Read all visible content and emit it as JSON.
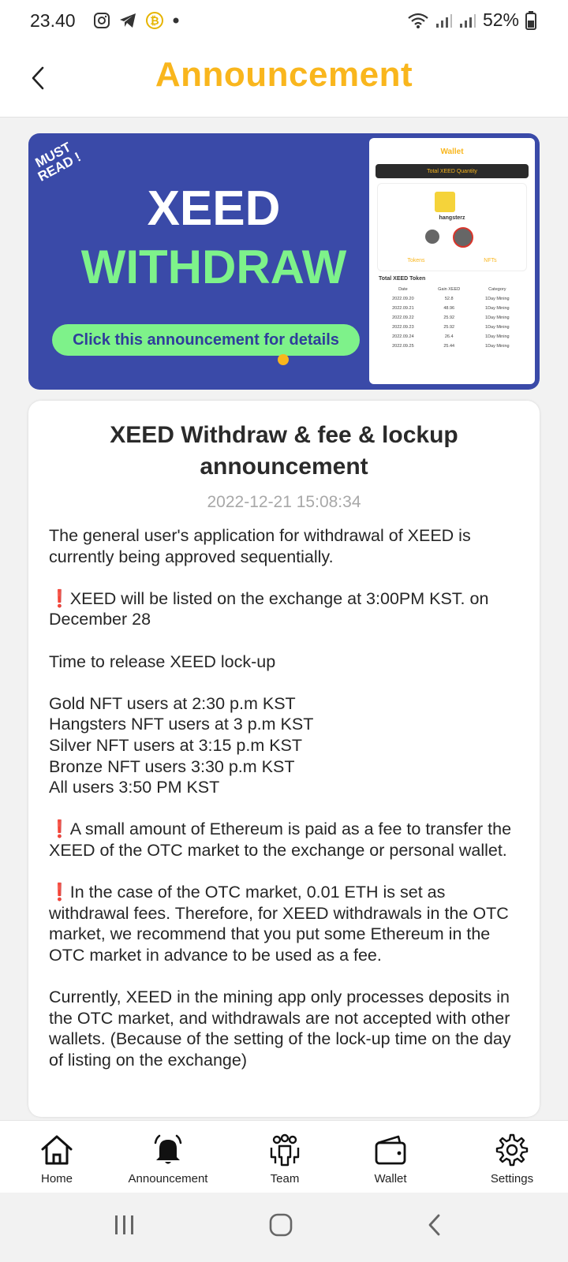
{
  "status_bar": {
    "time": "23.40",
    "battery": "52%",
    "icons": [
      "instagram-icon",
      "telegram-icon",
      "bitcoin-icon",
      "dot-icon",
      "wifi-icon",
      "signal-icon",
      "battery-icon"
    ]
  },
  "header": {
    "title": "Announcement",
    "title_color": "#f9b61d"
  },
  "banner": {
    "badge": "MUST\nREAD !",
    "line1": "XEED",
    "line2": "WITHDRAW",
    "cta": "Click this announcement for details",
    "phone": {
      "title": "Wallet",
      "bar_label": "Total XEED Quantity",
      "username": "hangsterz",
      "tab1": "Tokens",
      "tab2": "NFTs",
      "token_label": "Total XEED Token",
      "headers": [
        "Date",
        "Gain XEED",
        "Category"
      ],
      "rows": [
        [
          "2022.09.20",
          "52.8",
          "1Day Mining"
        ],
        [
          "2022.09.21",
          "48.96",
          "1Day Mining"
        ],
        [
          "2022.09.22",
          "25.92",
          "1Day Mining"
        ],
        [
          "2022.09.23",
          "25.92",
          "1Day Mining"
        ],
        [
          "2022.09.24",
          "26.4",
          "1Day Mining"
        ],
        [
          "2022.09.25",
          "25.44",
          "1Day Mining"
        ]
      ]
    }
  },
  "announcement": {
    "title": "XEED Withdraw & fee & lockup announcement",
    "date": "2022-12-21 15:08:34",
    "p1": "The general user's application for withdrawal of XEED is currently being approved sequentially.",
    "p2": "XEED will be listed on the exchange at 3:00PM KST. on December 28",
    "p3": "Time to release XEED lock-up",
    "schedule": [
      "Gold NFT users at 2:30 p.m KST",
      "Hangsters NFT users at 3 p.m KST",
      "Silver NFT users at 3:15 p.m KST",
      "Bronze NFT users 3:30 p.m KST",
      "All users 3:50 PM KST"
    ],
    "p4": "A small amount of Ethereum is paid as a fee to transfer the XEED of the OTC market to the exchange or personal wallet.",
    "p5": "In the case of the OTC market, 0.01 ETH is set as withdrawal fees. Therefore, for XEED withdrawals in the OTC market, we recommend that you put some Ethereum in the OTC market in advance to be used as a fee.",
    "p6": "Currently, XEED in the mining app only processes deposits in the OTC market, and withdrawals are not accepted with other wallets. (Because of the setting of the lock-up time on the day of listing on the exchange)",
    "mark": "❗"
  },
  "bottom_nav": {
    "home": "Home",
    "announcement": "Announcement",
    "team": "Team",
    "wallet": "Wallet",
    "settings": "Settings"
  }
}
